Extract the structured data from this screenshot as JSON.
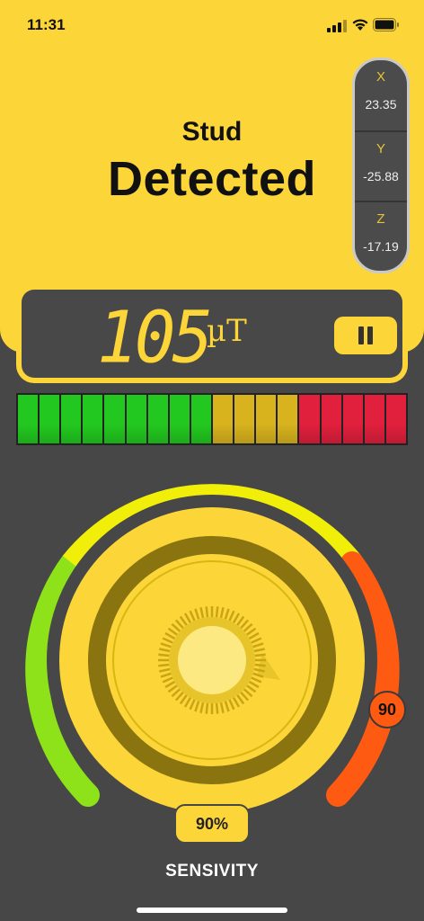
{
  "status_bar": {
    "time": "11:31"
  },
  "header": {
    "line1": "Stud",
    "line2": "Detected"
  },
  "axes": [
    {
      "name": "X",
      "value": "23.35"
    },
    {
      "name": "Y",
      "value": "-25.88"
    },
    {
      "name": "Z",
      "value": "-17.19"
    }
  ],
  "reading": {
    "value": "105",
    "unit": "µT",
    "pause_icon": "pause-icon"
  },
  "meter": {
    "segments": [
      "#22c81f",
      "#22c81f",
      "#22c81f",
      "#22c81f",
      "#22c81f",
      "#22c81f",
      "#22c81f",
      "#22c81f",
      "#22c81f",
      "#d8b31e",
      "#d8b31e",
      "#d8b31e",
      "#d8b31e",
      "#e0203d",
      "#e0203d",
      "#e0203d",
      "#e0203d",
      "#e0203d"
    ],
    "level_segments_active": 18
  },
  "dial": {
    "level_value": "90",
    "percent": "90%",
    "label": "SENSIVITY",
    "colors": {
      "green": "#8de21a",
      "yellow": "#f1ef0a",
      "red": "#ff5a12",
      "knob": "#fcd538"
    }
  }
}
